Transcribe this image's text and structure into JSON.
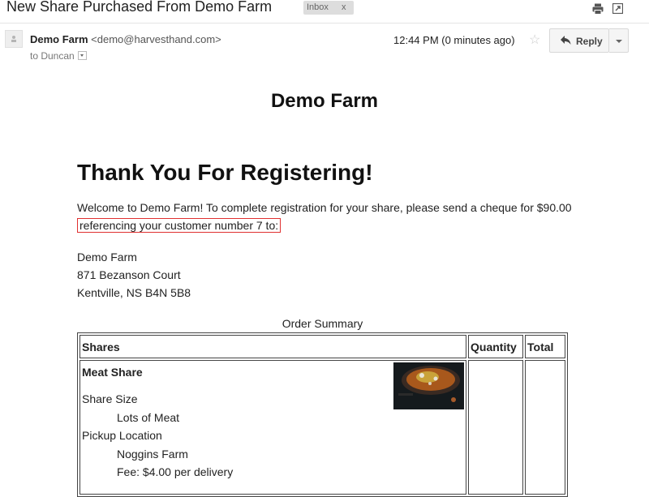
{
  "email": {
    "subject": "New Share Purchased From Demo Farm",
    "label_chip": "Inbox",
    "label_remove": "x",
    "sender_name": "Demo Farm",
    "sender_email": "<demo@harvesthand.com>",
    "to_text": "to Duncan",
    "time": "12:44 PM (0 minutes ago)",
    "reply_label": "Reply",
    "icons": [
      "print-icon",
      "new-window-icon",
      "avatar-icon",
      "star-icon",
      "reply-arrow-icon",
      "chevron-down-icon"
    ]
  },
  "body": {
    "farm_title": "Demo Farm",
    "heading": "Thank You For Registering!",
    "welcome_text": "Welcome to Demo Farm! To complete registration for your share, please send a cheque for $90.00",
    "welcome_highlight": "referencing your customer number 7 to:",
    "address": [
      "Demo Farm",
      "871 Bezanson Court",
      "Kentville, NS B4N 5B8"
    ],
    "order_caption": "Order Summary",
    "table": {
      "headers": [
        "Shares",
        "Quantity",
        "Total"
      ],
      "rows": [
        {
          "share_name": "Meat Share",
          "size_label": "Share Size",
          "size_value": "Lots of Meat",
          "pickup_label": "Pickup Location",
          "pickup_value": "Noggins Farm",
          "fee": "Fee: $4.00 per delivery"
        }
      ]
    }
  },
  "colors": {
    "highlight_border": "#e03030",
    "chip_bg": "#dddddd",
    "button_bg": "#f5f5f5"
  }
}
